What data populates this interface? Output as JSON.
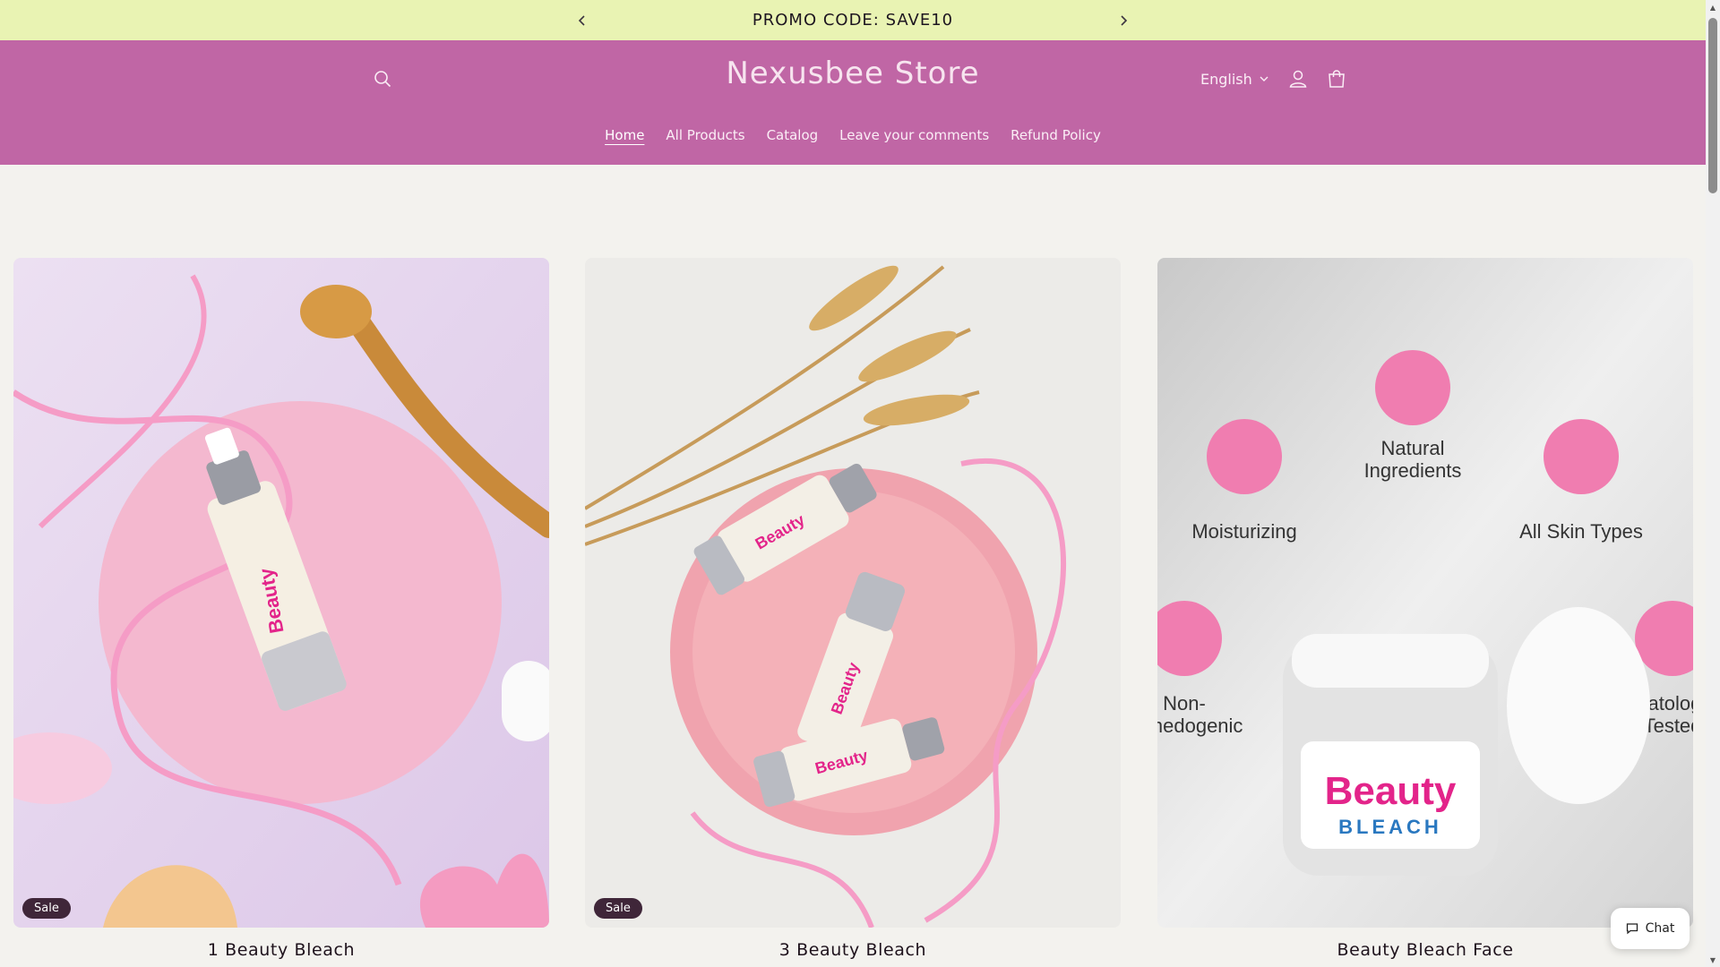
{
  "announcement": {
    "text": "PROMO CODE: SAVE10",
    "prev_icon": "chevron-left-icon",
    "next_icon": "chevron-right-icon"
  },
  "header": {
    "store_name": "Nexusbee Store",
    "language": "English",
    "icons": [
      "search-icon",
      "account-icon",
      "cart-icon"
    ],
    "background": "#c066a5"
  },
  "nav": {
    "items": [
      "Home",
      "All Products",
      "Catalog",
      "Leave your comments",
      "Refund Policy"
    ],
    "active": "Home"
  },
  "products": [
    {
      "name": "1 Beauty Bleach",
      "badge": "Sale"
    },
    {
      "name": "3 Beauty Bleach",
      "badge": "Sale"
    },
    {
      "name": "Beauty Bleach Face",
      "badge": ""
    }
  ],
  "product_image_text": {
    "brand_top": "Beauty",
    "brand_bottom": "BLEACH",
    "features": [
      "Natural Ingredients",
      "Moisturizing",
      "All Skin Types",
      "Non-\ncomedogenic",
      "Dermatologically Tested"
    ]
  },
  "chat": {
    "label": "Chat"
  },
  "colors": {
    "promo_bar": "#e9f3b3",
    "accent_pink": "#ee88b8",
    "badge": "#3f2639"
  }
}
